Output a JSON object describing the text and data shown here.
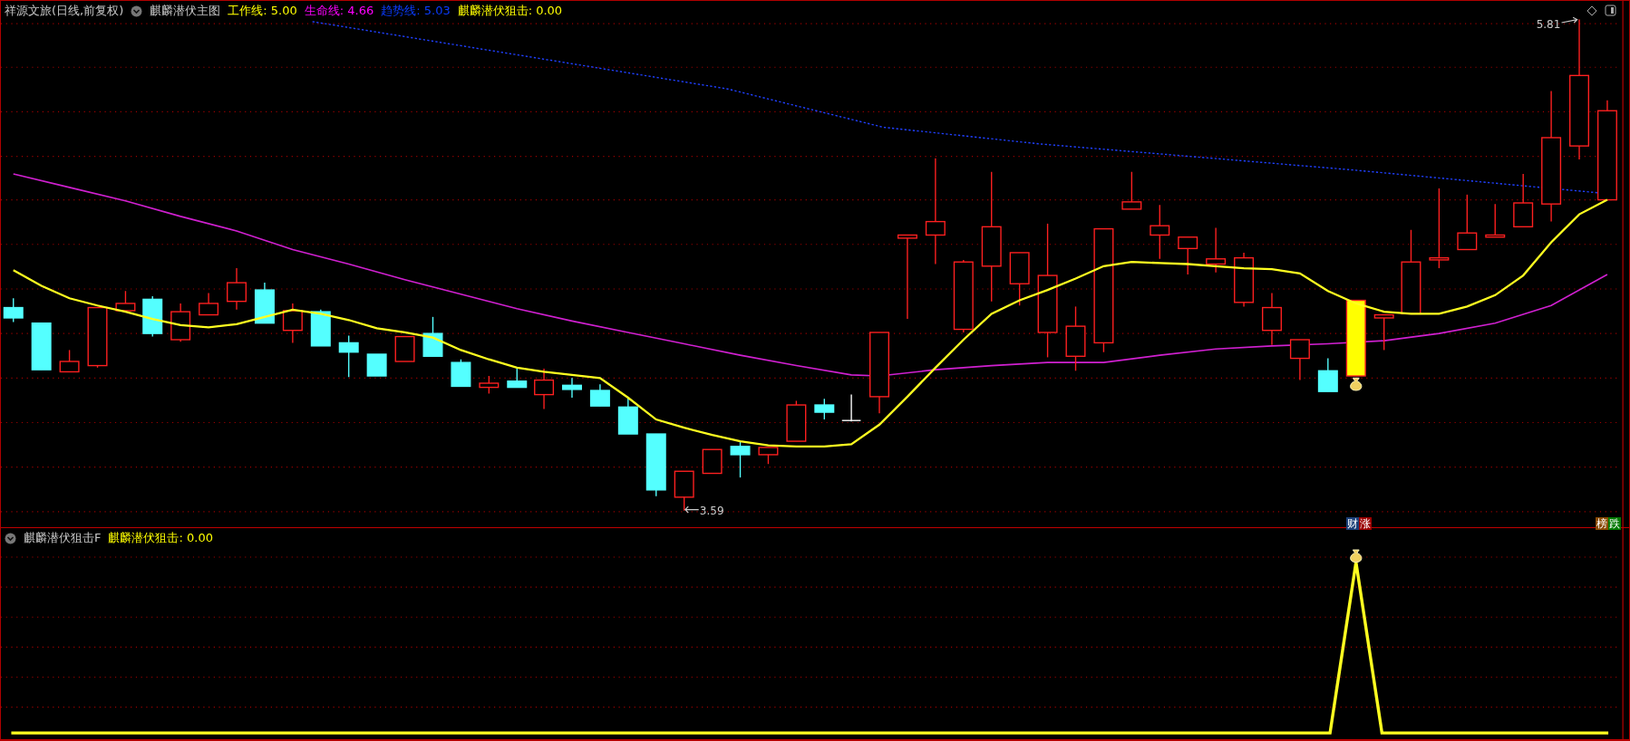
{
  "header": {
    "stock": "祥源文旅(日线,前复权)",
    "indicator": "麒麟潜伏主图",
    "values": [
      {
        "text": "工作线: 5.00",
        "color": "#ffff00"
      },
      {
        "text": "生命线: 4.66",
        "color": "#ff00ff"
      },
      {
        "text": "趋势线: 5.03",
        "color": "#0a3cff"
      },
      {
        "text": "麒麟潜伏狙击: 0.00",
        "color": "#ffff00"
      }
    ]
  },
  "main_chart": {
    "high_label": "5.81",
    "low_label": "3.59",
    "tags_left": [
      {
        "text": "财",
        "color": "#1c3f78"
      },
      {
        "text": "涨",
        "color": "#9c0000"
      }
    ],
    "tags_right": [
      {
        "text": "榜",
        "color": "#8a4a00"
      },
      {
        "text": "跌",
        "color": "#007a00"
      }
    ]
  },
  "sub_panel": {
    "indicator": "麒麟潜伏狙击F",
    "values": [
      {
        "text": "麒麟潜伏狙击: 0.00",
        "color": "#ffff00"
      }
    ]
  }
}
